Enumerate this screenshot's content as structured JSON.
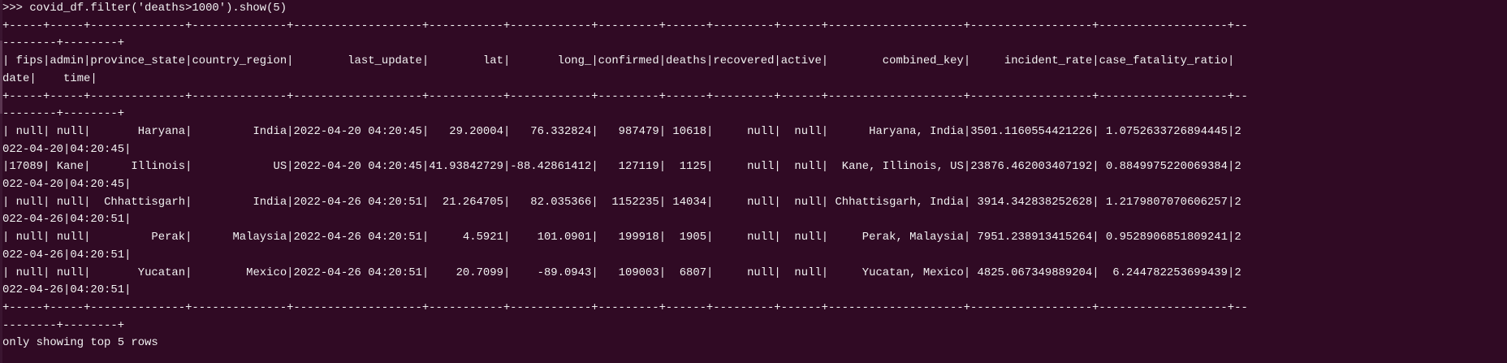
{
  "terminal": {
    "prompt": ">>> ",
    "command": "covid_df.filter('deaths>1000').show(5)",
    "footer": "only showing top 5 rows"
  },
  "table": {
    "columns": [
      {
        "name": "fips",
        "width": 5
      },
      {
        "name": "admin",
        "width": 5
      },
      {
        "name": "province_state",
        "width": 14
      },
      {
        "name": "country_region",
        "width": 14
      },
      {
        "name": "last_update",
        "width": 19
      },
      {
        "name": "lat",
        "width": 11
      },
      {
        "name": "long_",
        "width": 12
      },
      {
        "name": "confirmed",
        "width": 9
      },
      {
        "name": "deaths",
        "width": 6
      },
      {
        "name": "recovered",
        "width": 9
      },
      {
        "name": "active",
        "width": 6
      },
      {
        "name": "combined_key",
        "width": 20
      },
      {
        "name": "incident_rate",
        "width": 18
      },
      {
        "name": "case_fatality_ratio",
        "width": 19
      },
      {
        "name": "date",
        "width": 10
      },
      {
        "name": "time",
        "width": 8
      }
    ],
    "rows": [
      [
        "null",
        "null",
        "Haryana",
        "India",
        "2022-04-20 04:20:45",
        "29.20004",
        "76.332824",
        "987479",
        "10618",
        "null",
        "null",
        "Haryana, India",
        "3501.1160554421226",
        "1.0752633726894445",
        "2022-04-20",
        "04:20:45"
      ],
      [
        "17089",
        "Kane",
        "Illinois",
        "US",
        "2022-04-20 04:20:45",
        "41.93842729",
        "-88.42861412",
        "127119",
        "1125",
        "null",
        "null",
        "Kane, Illinois, US",
        "23876.462003407192",
        "0.8849975220069384",
        "2022-04-20",
        "04:20:45"
      ],
      [
        "null",
        "null",
        "Chhattisgarh",
        "India",
        "2022-04-26 04:20:51",
        "21.264705",
        "82.035366",
        "1152235",
        "14034",
        "null",
        "null",
        "Chhattisgarh, India",
        "3914.342838252628",
        "1.2179807070606257",
        "2022-04-26",
        "04:20:51"
      ],
      [
        "null",
        "null",
        "Perak",
        "Malaysia",
        "2022-04-26 04:20:51",
        "4.5921",
        "101.0901",
        "199918",
        "1905",
        "null",
        "null",
        "Perak, Malaysia",
        "7951.238913415264",
        "0.9528906851809241",
        "2022-04-26",
        "04:20:51"
      ],
      [
        "null",
        "null",
        "Yucatan",
        "Mexico",
        "2022-04-26 04:20:51",
        "20.7099",
        "-89.0943",
        "109003",
        "6807",
        "null",
        "null",
        "Yucatan, Mexico",
        "4825.067349889204",
        "6.244782253699439",
        "2022-04-26",
        "04:20:51"
      ]
    ]
  }
}
